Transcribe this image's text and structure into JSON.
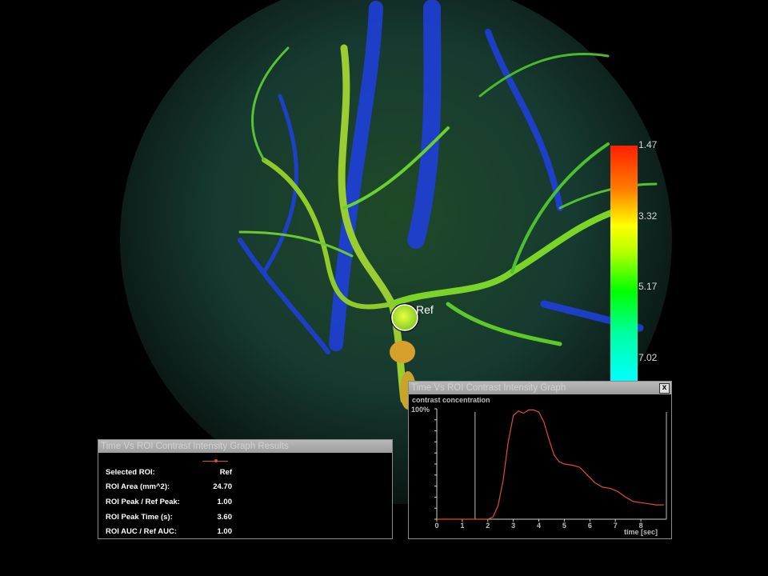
{
  "viewer": {
    "roi_label": "Ref",
    "colorbar_ticks": [
      "1.47",
      "3.32",
      "5.17",
      "7.02"
    ]
  },
  "results_panel": {
    "title": "Time Vs ROI Contrast Intensity Graph Results",
    "rows": [
      {
        "label": "Selected ROI:",
        "value": "Ref"
      },
      {
        "label": "ROI Area (mm^2):",
        "value": "24.70"
      },
      {
        "label": "ROI Peak / Ref Peak:",
        "value": "1.00"
      },
      {
        "label": "ROI Peak Time (s):",
        "value": "3.60"
      },
      {
        "label": "ROI AUC / Ref AUC:",
        "value": "1.00"
      }
    ],
    "legend_line_color": "#e0502a"
  },
  "graph_panel": {
    "title": "Time Vs ROI Contrast Intensity Graph",
    "close_label": "x",
    "y_axis_label": "contrast concentration",
    "y_top_tick": "100%",
    "x_axis_label": "time [sec]",
    "curve_color": "#e0502a"
  },
  "chart_data": {
    "type": "line",
    "xlabel": "time [sec]",
    "ylabel": "contrast concentration",
    "xlim": [
      0,
      9
    ],
    "ylim": [
      0,
      100
    ],
    "x_ticks": [
      "0",
      "1",
      "2",
      "3",
      "4",
      "5",
      "6",
      "7",
      "8"
    ],
    "y_ticks": [
      "100%"
    ],
    "vertical_markers": [
      1.5,
      9.0
    ],
    "series": [
      {
        "name": "Ref",
        "x": [
          0,
          1,
          2,
          2.2,
          2.4,
          2.6,
          2.8,
          3.0,
          3.2,
          3.4,
          3.6,
          3.8,
          4.0,
          4.2,
          4.4,
          4.6,
          4.8,
          5.0,
          5.3,
          5.6,
          5.9,
          6.2,
          6.5,
          6.8,
          7.1,
          7.4,
          7.7,
          8.0,
          8.3,
          8.6,
          8.9
        ],
        "y": [
          0,
          0,
          0,
          2,
          12,
          35,
          70,
          94,
          98,
          96,
          99,
          99,
          97,
          88,
          72,
          58,
          52,
          50,
          49,
          47,
          40,
          33,
          29,
          28,
          25,
          20,
          16,
          15,
          14,
          13,
          13
        ]
      }
    ]
  }
}
